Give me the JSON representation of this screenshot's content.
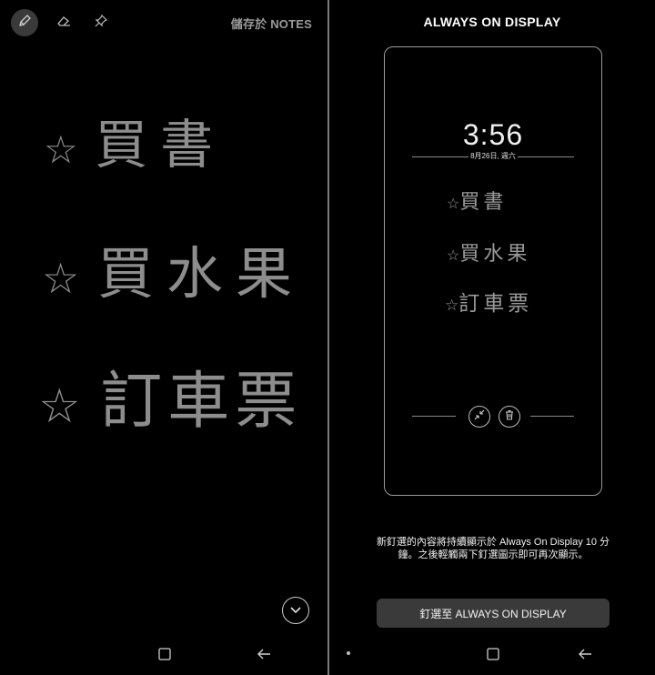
{
  "left": {
    "save_label": "儲存於 NOTES",
    "lines": [
      {
        "star": "☆",
        "text": "買書"
      },
      {
        "star": "☆",
        "text": "買水果"
      },
      {
        "star": "☆",
        "text": "訂車票"
      }
    ],
    "icons": [
      "pencil-icon",
      "eraser-icon",
      "pin-icon",
      "chevron-down-icon"
    ]
  },
  "right": {
    "title": "ALWAYS ON DISPLAY",
    "clock": "3:56",
    "date": "8月26日, 週六",
    "lines": [
      {
        "star": "☆",
        "text": "買書"
      },
      {
        "star": "☆",
        "text": "買水果"
      },
      {
        "star": "☆",
        "text": "訂車票"
      }
    ],
    "description": "新釘選的內容將持續顯示於 Always On Display 10 分鐘。之後輕觸兩下釘選圖示即可再次顯示。",
    "pin_button": "釘選至 ALWAYS ON DISPLAY"
  },
  "navbar": {
    "icons": [
      "recent-apps-icon",
      "back-icon",
      "dot-indicator"
    ]
  }
}
